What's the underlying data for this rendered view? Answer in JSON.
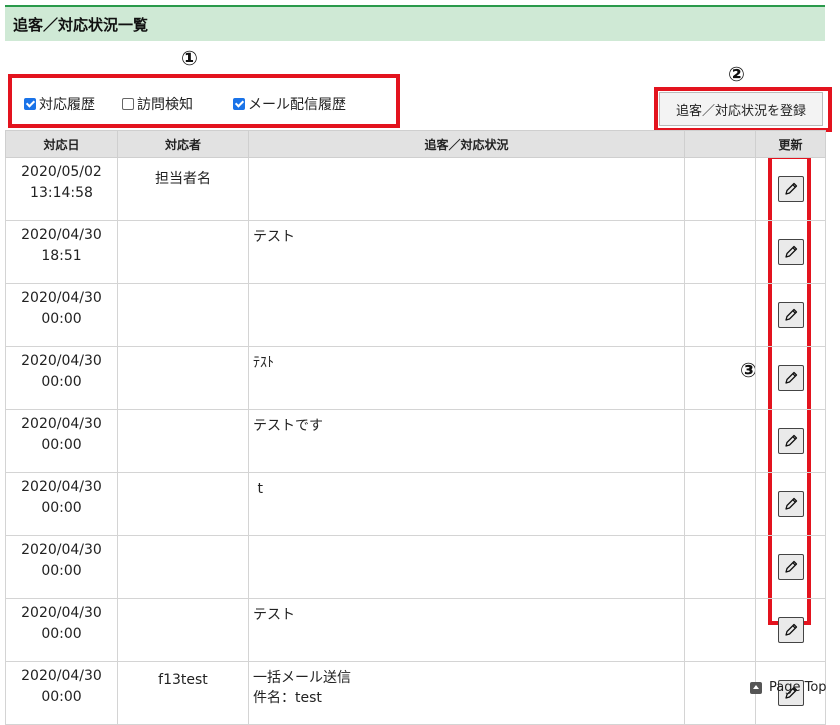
{
  "header": {
    "title": "追客／対応状況一覧"
  },
  "markers": {
    "m1": "①",
    "m2": "②",
    "m3": "③"
  },
  "filters": [
    {
      "label": "対応履歴",
      "checked": true
    },
    {
      "label": "訪問検知",
      "checked": false
    },
    {
      "label": "メール配信履歴",
      "checked": true
    }
  ],
  "register_button": {
    "label": "追客／対応状況を登録"
  },
  "table": {
    "headers": [
      "対応日",
      "対応者",
      "追客／対応状況",
      "",
      "更新"
    ],
    "rows": [
      {
        "date": "2020/05/02",
        "time": "13:14:58",
        "person": "担当者名",
        "status1": "",
        "status2": ""
      },
      {
        "date": "2020/04/30",
        "time": "18:51",
        "person": "",
        "status1": "テスト",
        "status2": ""
      },
      {
        "date": "2020/04/30",
        "time": "00:00",
        "person": "",
        "status1": "",
        "status2": ""
      },
      {
        "date": "2020/04/30",
        "time": "00:00",
        "person": "",
        "status1": "ﾃｽﾄ",
        "status2": ""
      },
      {
        "date": "2020/04/30",
        "time": "00:00",
        "person": "",
        "status1": "テストです",
        "status2": ""
      },
      {
        "date": "2020/04/30",
        "time": "00:00",
        "person": "",
        "status1": " t",
        "status2": ""
      },
      {
        "date": "2020/04/30",
        "time": "00:00",
        "person": "",
        "status1": "",
        "status2": ""
      },
      {
        "date": "2020/04/30",
        "time": "00:00",
        "person": "",
        "status1": "テスト",
        "status2": ""
      },
      {
        "date": "2020/04/30",
        "time": "00:00",
        "person": "f13test",
        "status1": "一括メール送信",
        "status2": "件名：test"
      }
    ]
  },
  "footer": {
    "page_top": "Page Top"
  },
  "colors": {
    "highlight": "#e3131e",
    "title_bg": "#cfe9d5",
    "title_border": "#2a9a4b"
  }
}
